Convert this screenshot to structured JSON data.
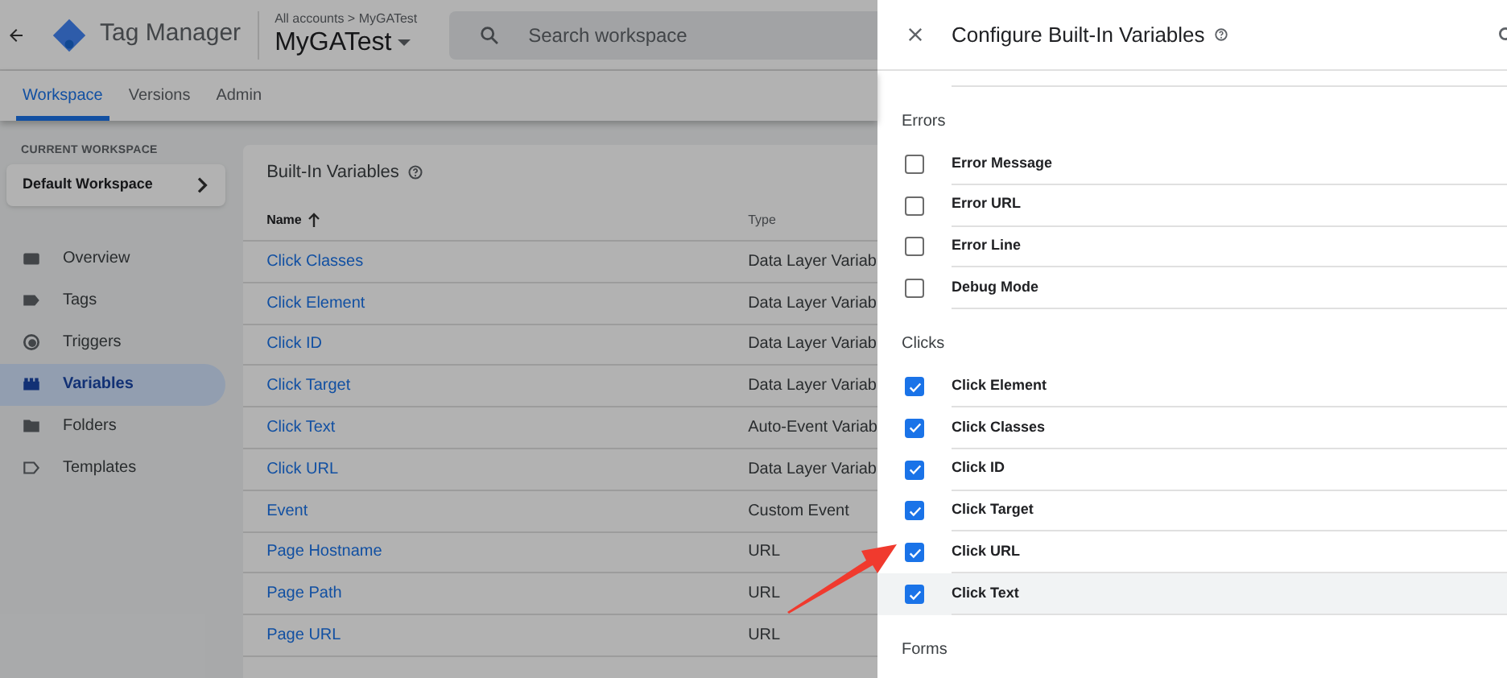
{
  "header": {
    "product": "Tag Manager",
    "breadcrumb": "All accounts > MyGATest",
    "container": "MyGATest",
    "search": {
      "placeholder": "Search workspace"
    }
  },
  "tabs": [
    {
      "label": "Workspace",
      "selected": true
    },
    {
      "label": "Versions",
      "selected": false
    },
    {
      "label": "Admin",
      "selected": false
    }
  ],
  "sidebar": {
    "workspace_label": "CURRENT WORKSPACE",
    "workspace": "Default Workspace",
    "items": [
      {
        "label": "Overview",
        "kind": "overview",
        "selected": false
      },
      {
        "label": "Tags",
        "kind": "tag",
        "selected": false
      },
      {
        "label": "Triggers",
        "kind": "trigger",
        "selected": false
      },
      {
        "label": "Variables",
        "kind": "variable",
        "selected": true
      },
      {
        "label": "Folders",
        "kind": "folder",
        "selected": false
      },
      {
        "label": "Templates",
        "kind": "template",
        "selected": false
      }
    ]
  },
  "table": {
    "title": "Built-In Variables",
    "columns": [
      "Name",
      "Type"
    ],
    "rows": [
      {
        "name": "Click Classes",
        "type": "Data Layer Variab"
      },
      {
        "name": "Click Element",
        "type": "Data Layer Variab"
      },
      {
        "name": "Click ID",
        "type": "Data Layer Variab"
      },
      {
        "name": "Click Target",
        "type": "Data Layer Variab"
      },
      {
        "name": "Click Text",
        "type": "Auto-Event Variab"
      },
      {
        "name": "Click URL",
        "type": "Data Layer Variab"
      },
      {
        "name": "Event",
        "type": "Custom Event"
      },
      {
        "name": "Page Hostname",
        "type": "URL"
      },
      {
        "name": "Page Path",
        "type": "URL"
      },
      {
        "name": "Page URL",
        "type": "URL"
      }
    ]
  },
  "panel": {
    "title": "Configure Built-In Variables",
    "sections": [
      {
        "title": "Errors",
        "items": [
          {
            "label": "Error Message",
            "checked": false,
            "hovered": false
          },
          {
            "label": "Error URL",
            "checked": false,
            "hovered": false
          },
          {
            "label": "Error Line",
            "checked": false,
            "hovered": false
          },
          {
            "label": "Debug Mode",
            "checked": false,
            "hovered": false
          }
        ]
      },
      {
        "title": "Clicks",
        "items": [
          {
            "label": "Click Element",
            "checked": true,
            "hovered": false
          },
          {
            "label": "Click Classes",
            "checked": true,
            "hovered": false
          },
          {
            "label": "Click ID",
            "checked": true,
            "hovered": false
          },
          {
            "label": "Click Target",
            "checked": true,
            "hovered": false
          },
          {
            "label": "Click URL",
            "checked": true,
            "hovered": false
          },
          {
            "label": "Click Text",
            "checked": true,
            "hovered": true
          }
        ]
      },
      {
        "title": "Forms"
      }
    ]
  }
}
